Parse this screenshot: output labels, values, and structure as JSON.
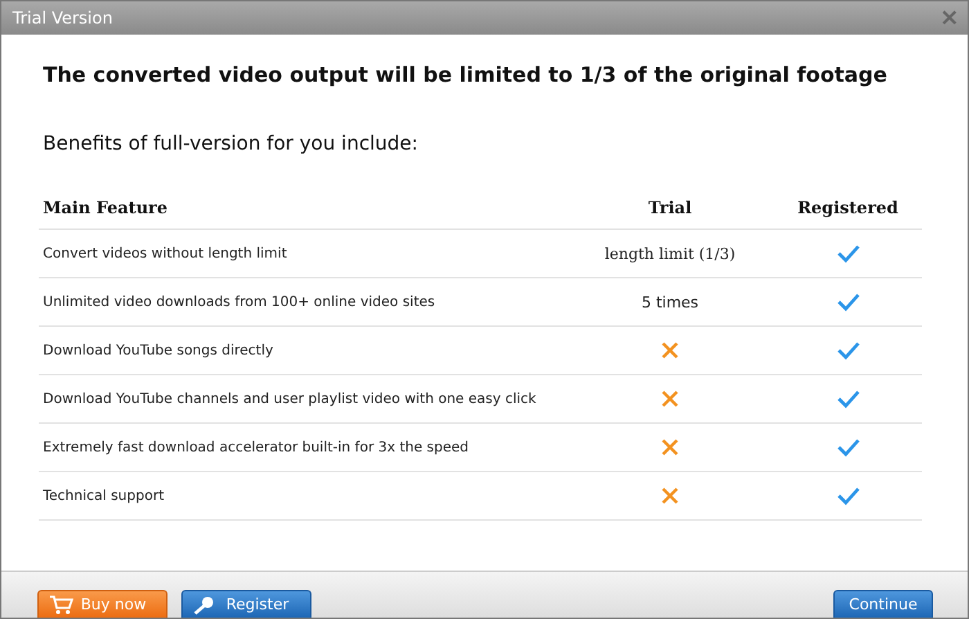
{
  "window": {
    "title": "Trial Version",
    "close": "×"
  },
  "heading": "The converted video output will be limited to 1/3 of the original footage",
  "subheading": "Benefits of full-version for you include:",
  "table": {
    "columns": [
      "Main Feature",
      "Trial",
      "Registered"
    ],
    "rows": [
      {
        "feature": "Convert videos without length limit",
        "trial": {
          "kind": "text",
          "text": "length limit (1/3)",
          "serif": true
        },
        "registered": {
          "kind": "check"
        }
      },
      {
        "feature": "Unlimited video downloads from 100+ online video sites",
        "trial": {
          "kind": "text",
          "text": "5 times",
          "serif": false
        },
        "registered": {
          "kind": "check"
        }
      },
      {
        "feature": "Download YouTube songs directly",
        "trial": {
          "kind": "cross"
        },
        "registered": {
          "kind": "check"
        }
      },
      {
        "feature": "Download YouTube channels and user playlist video with one easy click",
        "trial": {
          "kind": "cross"
        },
        "registered": {
          "kind": "check"
        }
      },
      {
        "feature": "Extremely fast download accelerator built-in for 3x the speed",
        "trial": {
          "kind": "cross"
        },
        "registered": {
          "kind": "check"
        }
      },
      {
        "feature": "Technical support",
        "trial": {
          "kind": "cross"
        },
        "registered": {
          "kind": "check"
        }
      }
    ]
  },
  "buttons": [
    {
      "label": "Buy now",
      "kind": "buy"
    },
    {
      "label": "Register",
      "kind": "register"
    },
    {
      "label": "Continue",
      "kind": "continue"
    }
  ]
}
